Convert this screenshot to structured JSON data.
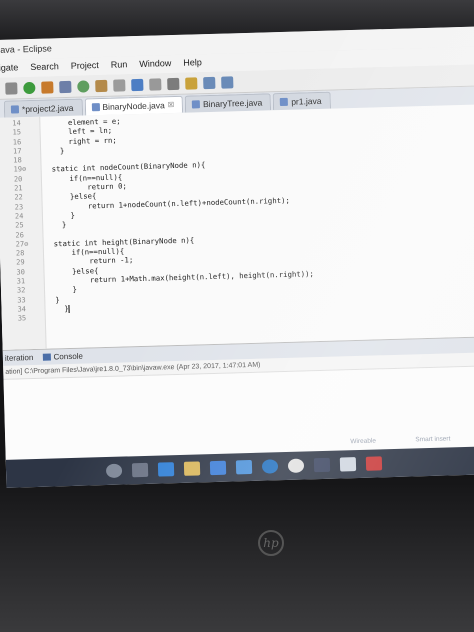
{
  "window": {
    "title": "ava - Eclipse"
  },
  "menu": [
    "igate",
    "Search",
    "Project",
    "Run",
    "Window",
    "Help"
  ],
  "tabs": [
    {
      "label": "*project2.java",
      "active": false
    },
    {
      "label": "BinaryNode.java",
      "active": true
    },
    {
      "label": "BinaryTree.java",
      "active": false
    },
    {
      "label": "pr1.java",
      "active": false
    }
  ],
  "tab_close_glyph": "☒",
  "editor": {
    "line_numbers": [
      "14",
      "15",
      "16",
      "17",
      "18",
      "19⊖",
      "20",
      "21",
      "22",
      "23",
      "24",
      "25",
      "26",
      "27⊖",
      "28",
      "29",
      "30",
      "31",
      "32",
      "33",
      "34",
      "35"
    ],
    "lines": [
      "    element = e;",
      "    left = ln;",
      "    right = rn;",
      "  }",
      "",
      "static int nodeCount(BinaryNode n){",
      "    if(n==null){",
      "        return 0;",
      "    }else{",
      "        return 1+nodeCount(n.left)+nodeCount(n.right);",
      "    }",
      "  }",
      "",
      "static int height(BinaryNode n){",
      "    if(n==null){",
      "        return -1;",
      "    }else{",
      "        return 1+Math.max(height(n.left), height(n.right));",
      "    }",
      "}",
      "  }",
      ""
    ]
  },
  "console": {
    "tabs": [
      "iteration",
      "Console"
    ],
    "path": "ation] C:\\Program Files\\Java\\jre1.8.0_73\\bin\\javaw.exe (Apr 23, 2017, 1:47:01 AM)"
  },
  "taskbar": {
    "tray_left": "Wireable",
    "tray_right": "Smart insert"
  },
  "brand": "hp",
  "colors": {
    "taskbar": "#2d3545",
    "editor_bg": "#fafafa",
    "tab_active": "#ffffff"
  }
}
